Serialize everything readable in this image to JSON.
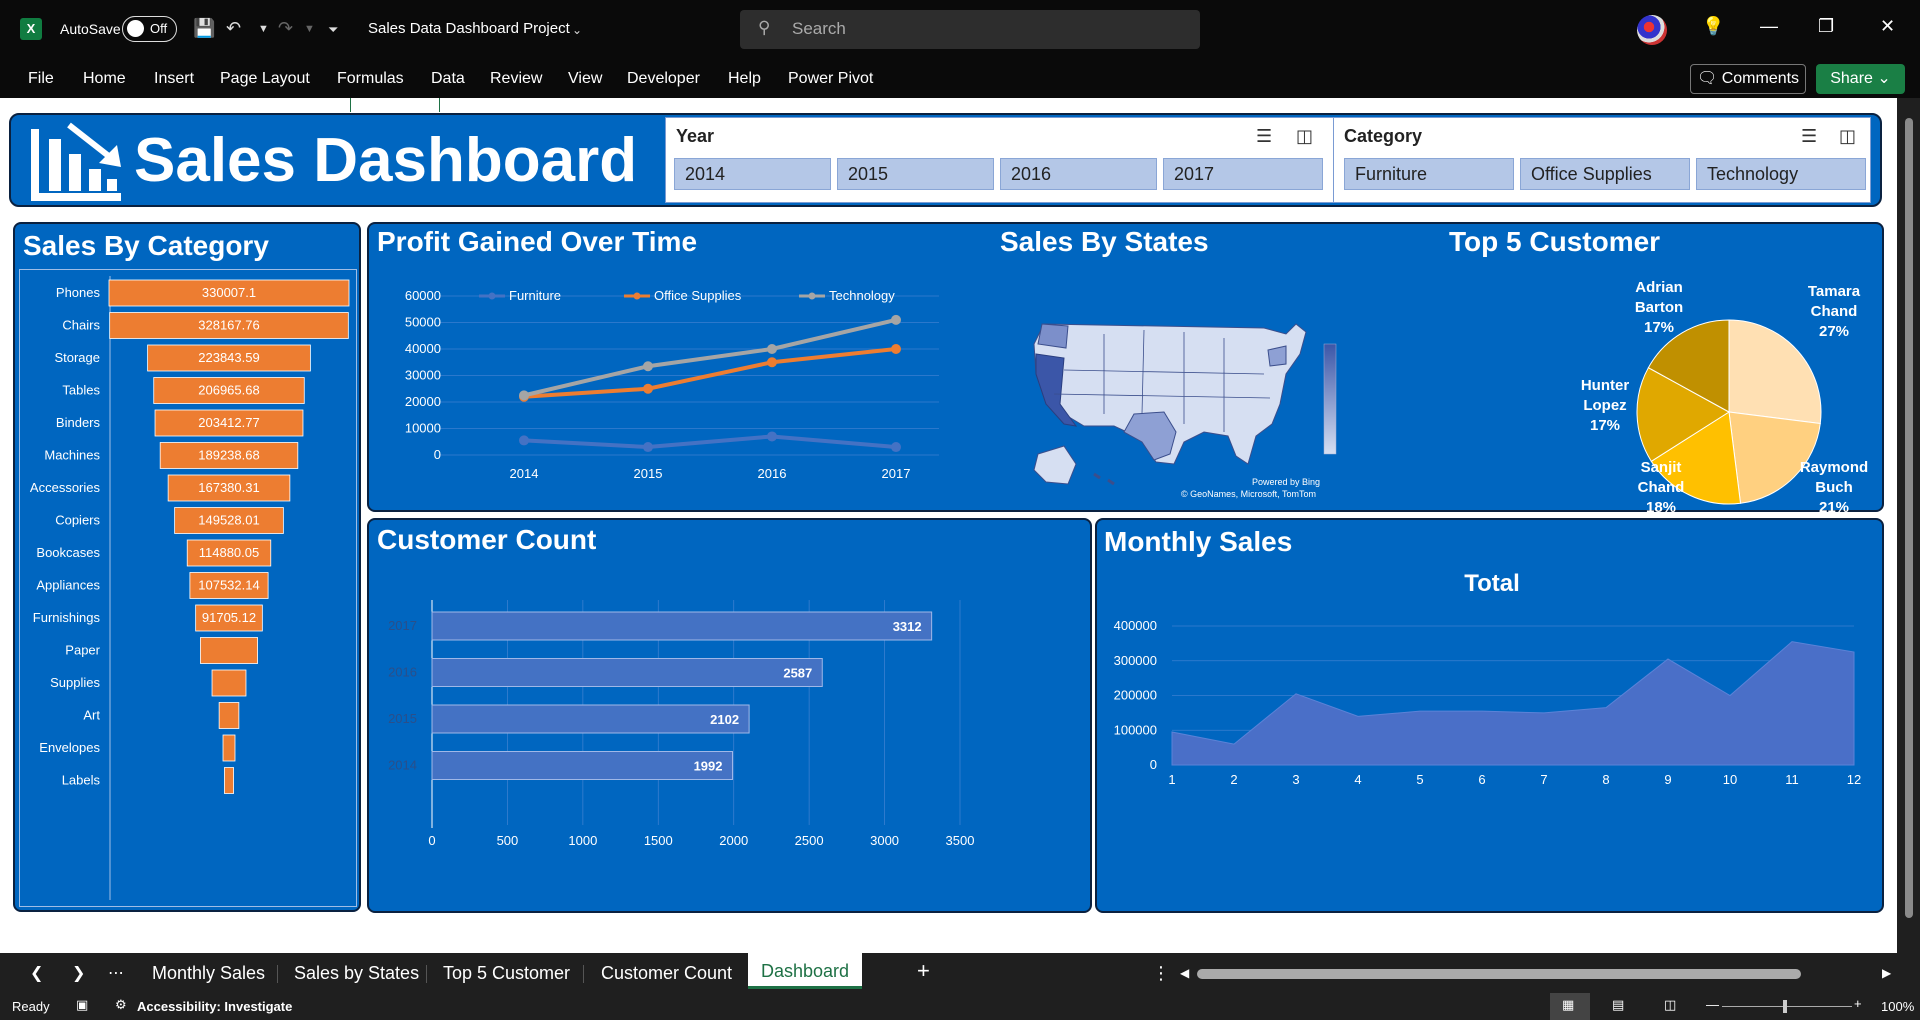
{
  "titlebar": {
    "app_icon": "X",
    "autosave_label": "AutoSave",
    "autosave_state": "Off",
    "doc_title": "Sales Data Dashboard Project",
    "search_placeholder": "Search"
  },
  "ribbon": {
    "tabs": [
      "File",
      "Home",
      "Insert",
      "Page Layout",
      "Formulas",
      "Data",
      "Review",
      "View",
      "Developer",
      "Help",
      "Power Pivot"
    ],
    "comments_label": "Comments",
    "share_label": "Share"
  },
  "dashboard": {
    "title": "Sales Dashboard",
    "year_slicer": {
      "header": "Year",
      "items": [
        "2014",
        "2015",
        "2016",
        "2017"
      ]
    },
    "category_slicer": {
      "header": "Category",
      "items": [
        "Furniture",
        "Office Supplies",
        "Technology"
      ]
    },
    "sales_by_category": {
      "title": "Sales By Category"
    },
    "profit": {
      "title": "Profit Gained Over Time"
    },
    "states": {
      "title": "Sales By States",
      "credit1": "Powered by Bing",
      "credit2": "© GeoNames, Microsoft, TomTom"
    },
    "top5": {
      "title": "Top 5 Customer"
    },
    "customer_count": {
      "title": "Customer Count"
    },
    "monthly": {
      "title": "Monthly Sales"
    }
  },
  "chart_data": [
    {
      "type": "bar",
      "title": "Sales By Category",
      "categories": [
        "Phones",
        "Chairs",
        "Storage",
        "Tables",
        "Binders",
        "Machines",
        "Accessories",
        "Copiers",
        "Bookcases",
        "Appliances",
        "Furnishings",
        "Paper",
        "Supplies",
        "Art",
        "Envelopes",
        "Labels"
      ],
      "values": [
        330007.1,
        328167.76,
        223843.59,
        206965.68,
        203412.77,
        189238.68,
        167380.31,
        149528.01,
        114880.05,
        107532.14,
        91705.12,
        78479,
        46674,
        27119,
        16476,
        12486
      ],
      "labels": [
        "330007.1",
        "328167.76",
        "223843.59",
        "206965.68",
        "203412.77",
        "189238.68",
        "167380.31",
        "149528.01",
        "114880.05",
        "107532.14",
        "91705.12",
        "",
        "",
        "",
        "",
        ""
      ]
    },
    {
      "type": "line",
      "title": "Profit Gained Over Time",
      "x": [
        "2014",
        "2015",
        "2016",
        "2017"
      ],
      "ylim": [
        0,
        60000
      ],
      "yticks": [
        "0",
        "10000",
        "20000",
        "30000",
        "40000",
        "50000",
        "60000"
      ],
      "legend": "top",
      "series": [
        {
          "name": "Furniture",
          "color": "#4472c4",
          "values": [
            5500,
            3000,
            7000,
            3000
          ]
        },
        {
          "name": "Office Supplies",
          "color": "#ed7d31",
          "values": [
            22000,
            25000,
            35000,
            40000
          ]
        },
        {
          "name": "Technology",
          "color": "#a5a5a5",
          "values": [
            22500,
            33500,
            40000,
            51000
          ]
        }
      ]
    },
    {
      "type": "pie",
      "title": "Top 5 Customer",
      "categories": [
        "Tamara Chand",
        "Raymond Buch",
        "Sanjit Chand",
        "Hunter Lopez",
        "Adrian Barton"
      ],
      "values": [
        27,
        21,
        18,
        17,
        17
      ],
      "labels": [
        "27%",
        "21%",
        "18%",
        "17%",
        "17%"
      ],
      "colors": [
        "#ffe0b3",
        "#ffd080",
        "#ffc000",
        "#e0a800",
        "#c09000"
      ]
    },
    {
      "type": "bar",
      "title": "Customer Count",
      "categories": [
        "2014",
        "2015",
        "2016",
        "2017"
      ],
      "values": [
        1992,
        2102,
        2587,
        3312
      ],
      "xlim": [
        0,
        3500
      ],
      "xticks": [
        "0",
        "500",
        "1000",
        "1500",
        "2000",
        "2500",
        "3000",
        "3500"
      ]
    },
    {
      "type": "area",
      "title": "Total",
      "x": [
        "1",
        "2",
        "3",
        "4",
        "5",
        "6",
        "7",
        "8",
        "9",
        "10",
        "11",
        "12"
      ],
      "values": [
        95000,
        60000,
        205000,
        140000,
        155000,
        155000,
        150000,
        165000,
        305000,
        200000,
        355000,
        325000
      ],
      "ylim": [
        0,
        400000
      ],
      "yticks": [
        "0",
        "100000",
        "200000",
        "300000",
        "400000"
      ]
    }
  ],
  "sheet_tabs": [
    "Monthly Sales",
    "Sales by States",
    "Top 5 Customer",
    "Customer Count",
    "Dashboard"
  ],
  "active_tab": "Dashboard",
  "status": {
    "ready": "Ready",
    "accessibility": "Accessibility: Investigate",
    "zoom": "100%"
  }
}
